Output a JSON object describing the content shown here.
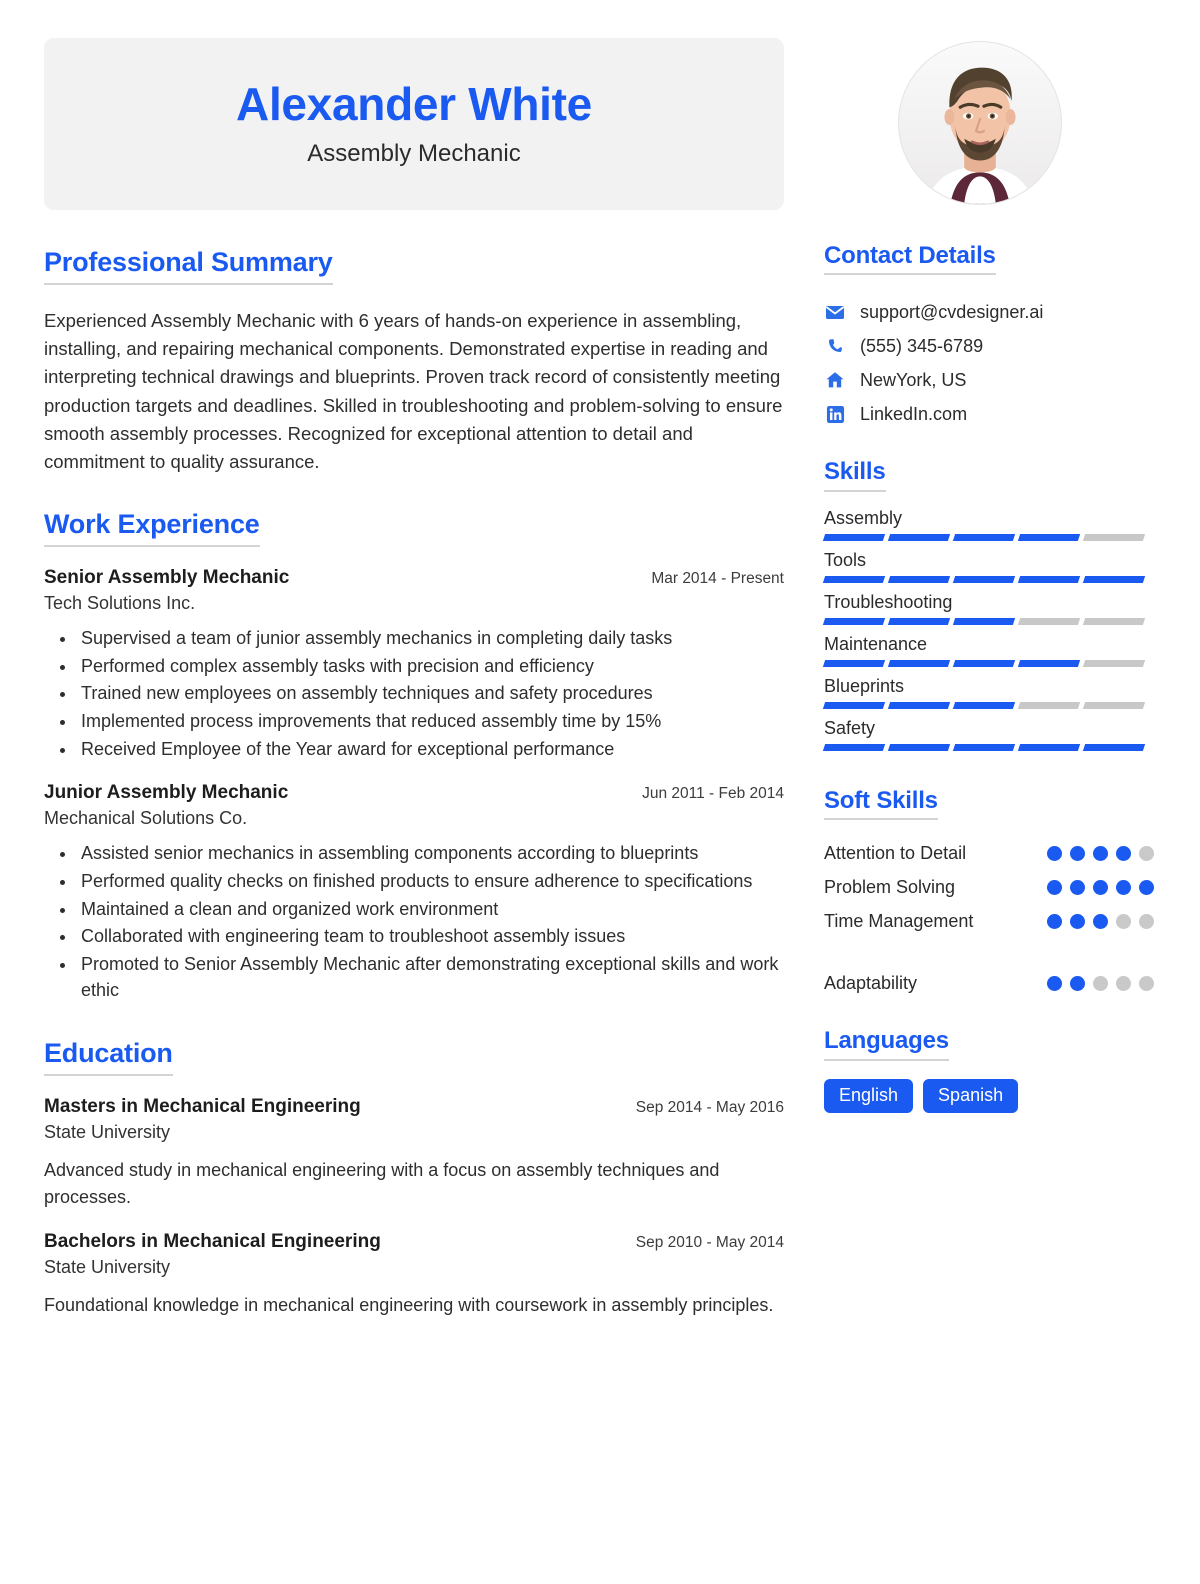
{
  "colors": {
    "accent": "#1a5af0",
    "accent_soft": "#2c6de8",
    "header_bg": "#f2f2f2",
    "rule": "#d4d4d4",
    "bar_empty": "#c8c8c8",
    "dot_empty": "#c9c9c9",
    "text": "#2b2b2b"
  },
  "header": {
    "name": "Alexander White",
    "title": "Assembly Mechanic",
    "avatar_alt": "profile-photo"
  },
  "summary": {
    "heading": "Professional Summary",
    "text": "Experienced Assembly Mechanic with 6 years of hands-on experience in assembling, installing, and repairing mechanical components. Demonstrated expertise in reading and interpreting technical drawings and blueprints. Proven track record of consistently meeting production targets and deadlines. Skilled in troubleshooting and problem-solving to ensure smooth assembly processes. Recognized for exceptional attention to detail and commitment to quality assurance."
  },
  "experience": {
    "heading": "Work Experience",
    "entries": [
      {
        "title": "Senior Assembly Mechanic",
        "date": "Mar 2014 - Present",
        "company": "Tech Solutions Inc.",
        "bullets": [
          "Supervised a team of junior assembly mechanics in completing daily tasks",
          "Performed complex assembly tasks with precision and efficiency",
          "Trained new employees on assembly techniques and safety procedures",
          "Implemented process improvements that reduced assembly time by 15%",
          "Received Employee of the Year award for exceptional performance"
        ]
      },
      {
        "title": "Junior Assembly Mechanic",
        "date": "Jun 2011 - Feb 2014",
        "company": "Mechanical Solutions Co.",
        "bullets": [
          "Assisted senior mechanics in assembling components according to blueprints",
          "Performed quality checks on finished products to ensure adherence to specifications",
          "Maintained a clean and organized work environment",
          "Collaborated with engineering team to troubleshoot assembly issues",
          "Promoted to Senior Assembly Mechanic after demonstrating exceptional skills and work ethic"
        ]
      }
    ]
  },
  "education": {
    "heading": "Education",
    "entries": [
      {
        "degree": "Masters in Mechanical Engineering",
        "date": "Sep 2014 - May 2016",
        "school": "State University",
        "description": "Advanced study in mechanical engineering with a focus on assembly techniques and processes."
      },
      {
        "degree": "Bachelors in Mechanical Engineering",
        "date": "Sep 2010 - May 2014",
        "school": "State University",
        "description": "Foundational knowledge in mechanical engineering with coursework in assembly principles."
      }
    ]
  },
  "contact": {
    "heading": "Contact Details",
    "items": [
      {
        "icon": "envelope-icon",
        "value": "support@cvdesigner.ai"
      },
      {
        "icon": "phone-icon",
        "value": "(555) 345-6789"
      },
      {
        "icon": "home-icon",
        "value": "NewYork, US"
      },
      {
        "icon": "linkedin-icon",
        "value": "LinkedIn.com"
      }
    ]
  },
  "skills": {
    "heading": "Skills",
    "max_level": 5,
    "items": [
      {
        "name": "Assembly",
        "level": 4
      },
      {
        "name": "Tools",
        "level": 5
      },
      {
        "name": "Troubleshooting",
        "level": 3
      },
      {
        "name": "Maintenance",
        "level": 4
      },
      {
        "name": "Blueprints",
        "level": 3
      },
      {
        "name": "Safety",
        "level": 5
      }
    ]
  },
  "soft_skills": {
    "heading": "Soft Skills",
    "max_level": 5,
    "items": [
      {
        "name": "Attention to Detail",
        "level": 4,
        "gap_before": false
      },
      {
        "name": "Problem Solving",
        "level": 5,
        "gap_before": false
      },
      {
        "name": "Time Management",
        "level": 3,
        "gap_before": false
      },
      {
        "name": "Adaptability",
        "level": 2,
        "gap_before": true
      }
    ]
  },
  "languages": {
    "heading": "Languages",
    "items": [
      "English",
      "Spanish"
    ]
  }
}
